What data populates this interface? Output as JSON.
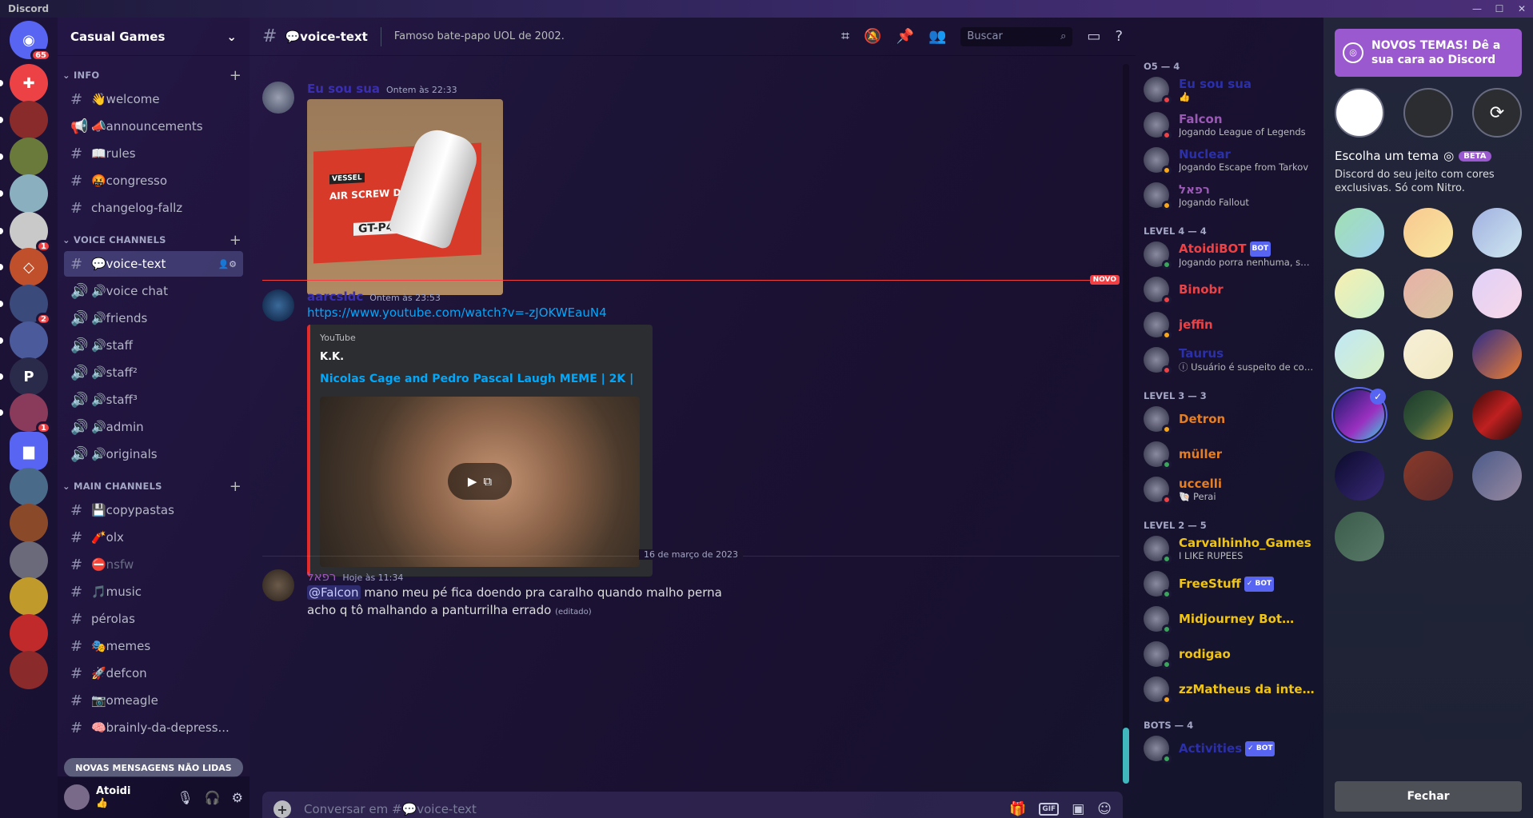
{
  "app": {
    "title": "Discord"
  },
  "window": {
    "minimize": "—",
    "maximize": "☐",
    "close": "✕"
  },
  "guilds": {
    "home_badge": "65",
    "items": [
      {
        "name": "Discord home",
        "color": "#5865f2",
        "glyph": "◉",
        "badge": "65"
      },
      {
        "name": "Games",
        "color": "#ed4245",
        "glyph": "✚",
        "badge": ""
      },
      {
        "name": "Server 1",
        "color": "#8a2b2b",
        "glyph": "",
        "badge": ""
      },
      {
        "name": "Server 2",
        "color": "#6a7a3a",
        "glyph": "",
        "badge": ""
      },
      {
        "name": "Server 3",
        "color": "#8ab0c0",
        "glyph": "",
        "badge": ""
      },
      {
        "name": "Server 4",
        "color": "#c9c9c9",
        "glyph": "",
        "badge": "1"
      },
      {
        "name": "Server 5",
        "color": "#c0502b",
        "glyph": "◇",
        "badge": ""
      },
      {
        "name": "Server 6",
        "color": "#3a4a7a",
        "glyph": "",
        "badge": "2"
      },
      {
        "name": "Server 7",
        "color": "#4a5a9a",
        "glyph": "",
        "badge": ""
      },
      {
        "name": "Server 8",
        "color": "#2a2a4a",
        "glyph": "P",
        "badge": ""
      },
      {
        "name": "Server 9",
        "color": "#8a3a5a",
        "glyph": "",
        "badge": "1"
      },
      {
        "name": "Folder",
        "color": "#5865f2",
        "glyph": "▆",
        "badge": ""
      },
      {
        "name": "Server 10",
        "color": "#4a6a8a",
        "glyph": "",
        "badge": ""
      },
      {
        "name": "Server 11",
        "color": "#8a4a2a",
        "glyph": "",
        "badge": ""
      },
      {
        "name": "Server 12",
        "color": "#6a6a7a",
        "glyph": "",
        "badge": ""
      },
      {
        "name": "Server 13",
        "color": "#c09a2a",
        "glyph": "",
        "badge": ""
      },
      {
        "name": "Server 14",
        "color": "#c02a2a",
        "glyph": "",
        "badge": ""
      },
      {
        "name": "Server 15",
        "color": "#8a2a2a",
        "glyph": "",
        "badge": ""
      }
    ]
  },
  "server": {
    "name": "Casual Games"
  },
  "categories": {
    "info": {
      "label": "INFO",
      "channels": [
        {
          "icon": "#",
          "label": "👋welcome"
        },
        {
          "icon": "📢",
          "label": "📣announcements"
        },
        {
          "icon": "#",
          "label": "📖rules"
        },
        {
          "icon": "#",
          "label": "🤬congresso"
        },
        {
          "icon": "#",
          "label": "changelog-fallz"
        }
      ]
    },
    "voice": {
      "label": "VOICE CHANNELS",
      "channels": [
        {
          "icon": "#",
          "label": "💬voice-text"
        },
        {
          "icon": "🔊",
          "label": "🔊voice chat"
        },
        {
          "icon": "🔊",
          "label": "🔊friends"
        },
        {
          "icon": "🔊",
          "label": "🔊staff"
        },
        {
          "icon": "🔊",
          "label": "🔊staff²"
        },
        {
          "icon": "🔊",
          "label": "🔊staff³"
        },
        {
          "icon": "🔊",
          "label": "🔊admin"
        },
        {
          "icon": "🔊",
          "label": "🔊originals"
        }
      ]
    },
    "main": {
      "label": "MAIN CHANNELS",
      "channels": [
        {
          "icon": "#",
          "label": "💾copypastas"
        },
        {
          "icon": "#",
          "label": "🧨olx"
        },
        {
          "icon": "#",
          "label": "⛔nsfw"
        },
        {
          "icon": "#",
          "label": "🎵music"
        },
        {
          "icon": "#",
          "label": "pérolas"
        },
        {
          "icon": "#",
          "label": "🎭memes"
        },
        {
          "icon": "#",
          "label": "🚀defcon"
        },
        {
          "icon": "#",
          "label": "📷omeagle"
        },
        {
          "icon": "#",
          "label": "🧠brainly-da-depress..."
        }
      ]
    }
  },
  "new_unread": "NOVAS MENSAGENS NÃO LIDAS",
  "user": {
    "name": "Atoidi",
    "status": "👍"
  },
  "channel_header": {
    "name": "💬voice-text",
    "topic": "Famoso bate-papo UOL de 2002.",
    "search_placeholder": "Buscar"
  },
  "messages": [
    {
      "author": "Eu sou sua",
      "time": "Ontem às 22:33",
      "author_color": "#2b2fa8",
      "image_labels": {
        "brand": "VESSEL",
        "text": "AIR SCREW DRIVER",
        "model": "GT-P4.5DR"
      }
    },
    {
      "author": "aarcsldc",
      "time": "Ontem às 23:53",
      "link": "https://www.youtube.com/watch?v=-zJOKWEauN4",
      "embed": {
        "provider": "YouTube",
        "author": "K.K.",
        "title": "Nicolas Cage and Pedro Pascal Laugh MEME | 2K |"
      }
    },
    {
      "author": "רפאל",
      "time": "Hoje às 11:34",
      "mention": "@Falcon",
      "text1": " mano meu pé fica doendo pra caralho quando malho perna",
      "text2": "acho q tô malhando a panturrilha errado",
      "edited": "(editado)"
    }
  ],
  "new_marker": "NOVO",
  "date_divider": "16 de março de 2023",
  "composer": {
    "placeholder": "Conversar em #💬voice-text",
    "gif": "GIF"
  },
  "members": {
    "groups": [
      {
        "label": "O5 — 4",
        "members": [
          {
            "name": "Eu sou sua",
            "status": "👍",
            "color": "#2b2fa8",
            "dot": "#ed4245"
          },
          {
            "name": "Falcon",
            "status": "Jogando League of Legends",
            "color": "#9b59b6",
            "dot": "#ed4245"
          },
          {
            "name": "Nuclear",
            "status": "Jogando Escape from Tarkov",
            "color": "#2b2fa8",
            "dot": "#faa61a"
          },
          {
            "name": "רפאל",
            "status": "Jogando Fallout",
            "color": "#9b59b6",
            "dot": "#faa61a"
          }
        ]
      },
      {
        "label": "LEVEL 4 — 4",
        "members": [
          {
            "name": "AtoidiBOT",
            "status": "Jogando porra nenhuma, soc...",
            "color": "#ed4245",
            "dot": "#3ba55c",
            "bot": "BOT"
          },
          {
            "name": "Binobr",
            "status": "",
            "color": "#ed4245",
            "dot": "#ed4245"
          },
          {
            "name": "jeffin",
            "status": "",
            "color": "#ed4245",
            "dot": "#faa61a"
          },
          {
            "name": "Taurus",
            "status": "ⓘ Usuário é suspeito de com...",
            "color": "#2b2fa8",
            "dot": "#ed4245"
          }
        ]
      },
      {
        "label": "LEVEL 3 — 3",
        "members": [
          {
            "name": "Detron",
            "status": "",
            "color": "#e67e22",
            "dot": "#faa61a"
          },
          {
            "name": "müller",
            "status": "",
            "color": "#e67e22",
            "dot": "#3ba55c"
          },
          {
            "name": "uccelli",
            "status": "🐚 Perai",
            "color": "#e67e22",
            "dot": "#ed4245"
          }
        ]
      },
      {
        "label": "LEVEL 2 — 5",
        "members": [
          {
            "name": "Carvalhinho_Games",
            "status": "I LIKE RUPEES",
            "color": "#f1c40f",
            "dot": "#3ba55c"
          },
          {
            "name": "FreeStuff",
            "status": "",
            "color": "#f1c40f",
            "dot": "#3ba55c",
            "bot": "✓ BOT"
          },
          {
            "name": "Midjourney Bot",
            "status": "",
            "color": "#f1c40f",
            "dot": "#3ba55c",
            "bot": "✓ BOT"
          },
          {
            "name": "rodigao",
            "status": "",
            "color": "#f1c40f",
            "dot": "#3ba55c"
          },
          {
            "name": "zzMatheus da integra...",
            "status": "",
            "color": "#f1c40f",
            "dot": "#faa61a"
          }
        ]
      },
      {
        "label": "BOTS — 4",
        "members": [
          {
            "name": "Activities",
            "status": "",
            "color": "#2b2fa8",
            "dot": "#3ba55c",
            "bot": "✓ BOT"
          }
        ]
      }
    ]
  },
  "theme_panel": {
    "banner": "NOVOS TEMAS! Dê a sua cara ao Discord",
    "title": "Escolha um tema",
    "beta": "BETA",
    "description": "Discord do seu jeito com cores exclusivas. Só com Nitro.",
    "close": "Fechar",
    "swatches": [
      "linear-gradient(135deg,#a0e0b0,#a0d0f0)",
      "linear-gradient(135deg,#f8c890,#f8e8a0)",
      "linear-gradient(135deg,#a0b0e0,#d0e8f0)",
      "linear-gradient(135deg,#f8f0b0,#c8f0d0)",
      "linear-gradient(135deg,#e8b0a8,#d8c8a0)",
      "linear-gradient(135deg,#e0d0f8,#f8d8e8)",
      "linear-gradient(135deg,#c0e8f8,#d8f0c0)",
      "linear-gradient(135deg,#f8f0d8,#f0e8c0)",
      "linear-gradient(135deg,#2a2a8a,#f08030)",
      "linear-gradient(135deg,#1a1a6a,#9a30c0 60%,#3ad0e0)",
      "linear-gradient(135deg,#1a3a2a,#3a5a3a 50%,#c0a030)",
      "linear-gradient(135deg,#3a0a0a,#c02020 50%,#1a0a0a)",
      "linear-gradient(135deg,#0a0a2a,#3a2a7a)",
      "linear-gradient(135deg,#8a3a2a,#5a2a2a)",
      "linear-gradient(135deg,#4a5a8a,#9a8aa0)",
      "linear-gradient(135deg,#3a5a4a,#5a7a6a)"
    ]
  }
}
